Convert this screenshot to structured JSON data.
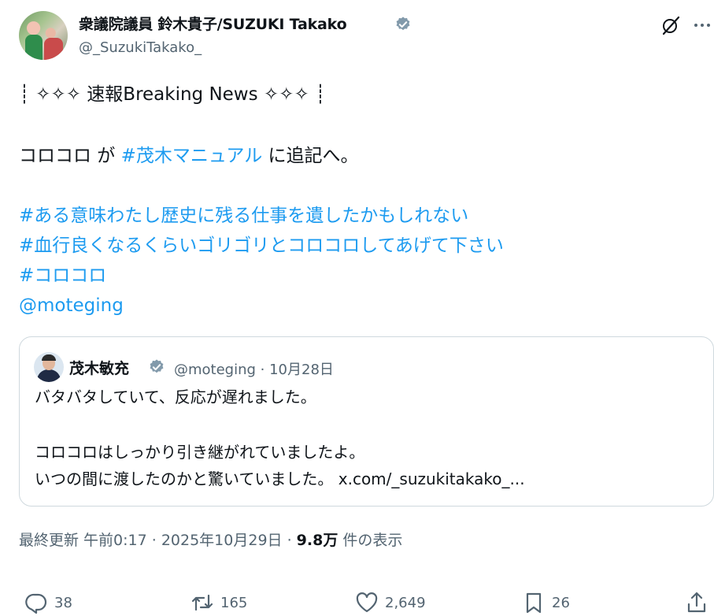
{
  "author": {
    "name": "衆議院議員 鈴木貴子/SUZUKI Takako",
    "handle": "@_SuzukiTakako_"
  },
  "icons": {
    "verified": "verified-badge-icon",
    "grok": "grok-icon",
    "more": "more-options-icon",
    "reply": "reply-icon",
    "retweet": "retweet-icon",
    "like": "like-icon",
    "bookmark": "bookmark-icon",
    "share": "share-icon"
  },
  "colors": {
    "link": "#1d9bf0",
    "verified": "#829aab",
    "secondary_text": "#536471",
    "border": "#cfd9de"
  },
  "tweet": {
    "line1": "┊ ✧✧✧ 速報Breaking News ✧✧✧ ┊",
    "line2_a": "コロコロ が ",
    "line2_tag": "#茂木マニュアル",
    "line2_b": " に追記へ。",
    "tag1": "#ある意味わたし歴史に残る仕事を遺したかもしれない",
    "tag2": "#血行良くなるくらいゴリゴリとコロコロしてあげて下さい",
    "tag3": "#コロコロ",
    "mention": "@moteging"
  },
  "quote": {
    "name": "茂木敏充",
    "meta": "@moteging · 10月28日",
    "line1": "バタバタしていて、反応が遅れました。",
    "line2": "コロコロはしっかり引き継がれていましたよ。",
    "line3": "いつの間に渡したのかと驚いていました。 x.com/_suzukitakako_..."
  },
  "stats": {
    "updated": "最終更新 午前0:17 · 2025年10月29日 · ",
    "views": "9.8万",
    "views_label": " 件の表示"
  },
  "actions": {
    "replies": "38",
    "retweets": "165",
    "likes": "2,649",
    "bookmarks": "26"
  }
}
